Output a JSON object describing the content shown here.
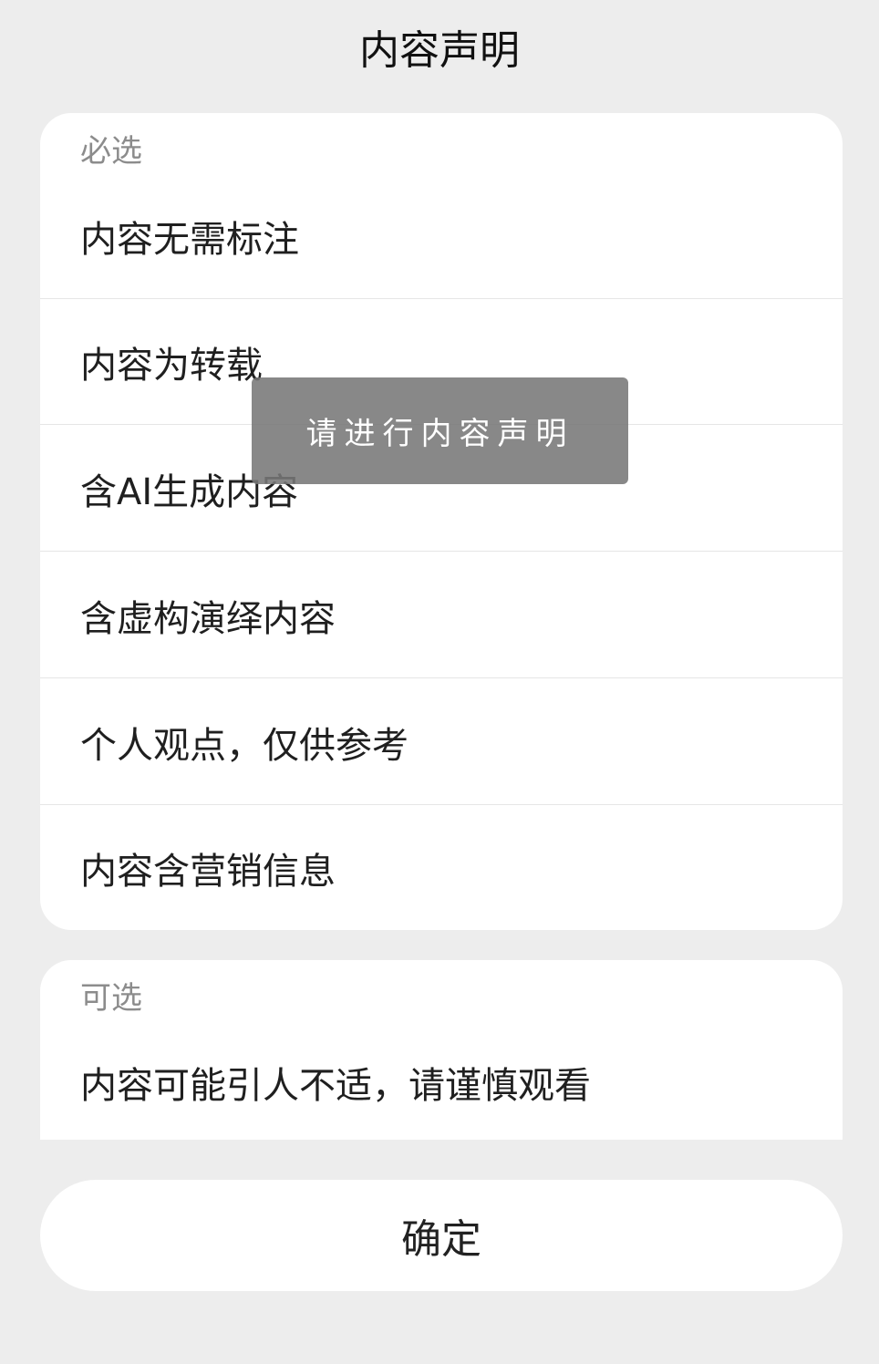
{
  "dialog": {
    "title": "内容声明"
  },
  "required_section": {
    "label": "必选",
    "options": [
      "内容无需标注",
      "内容为转载",
      "含AI生成内容",
      "含虚构演绎内容",
      "个人观点，仅供参考",
      "内容含营销信息"
    ]
  },
  "optional_section": {
    "label": "可选",
    "options": [
      "内容可能引人不适，请谨慎观看"
    ]
  },
  "confirm_button": {
    "label": "确定"
  },
  "toast": {
    "message": "请进行内容声明"
  },
  "colors": {
    "background": "#ededed",
    "card": "#ffffff",
    "section_label": "#8c8c8c",
    "toast_bg": "#787878"
  }
}
